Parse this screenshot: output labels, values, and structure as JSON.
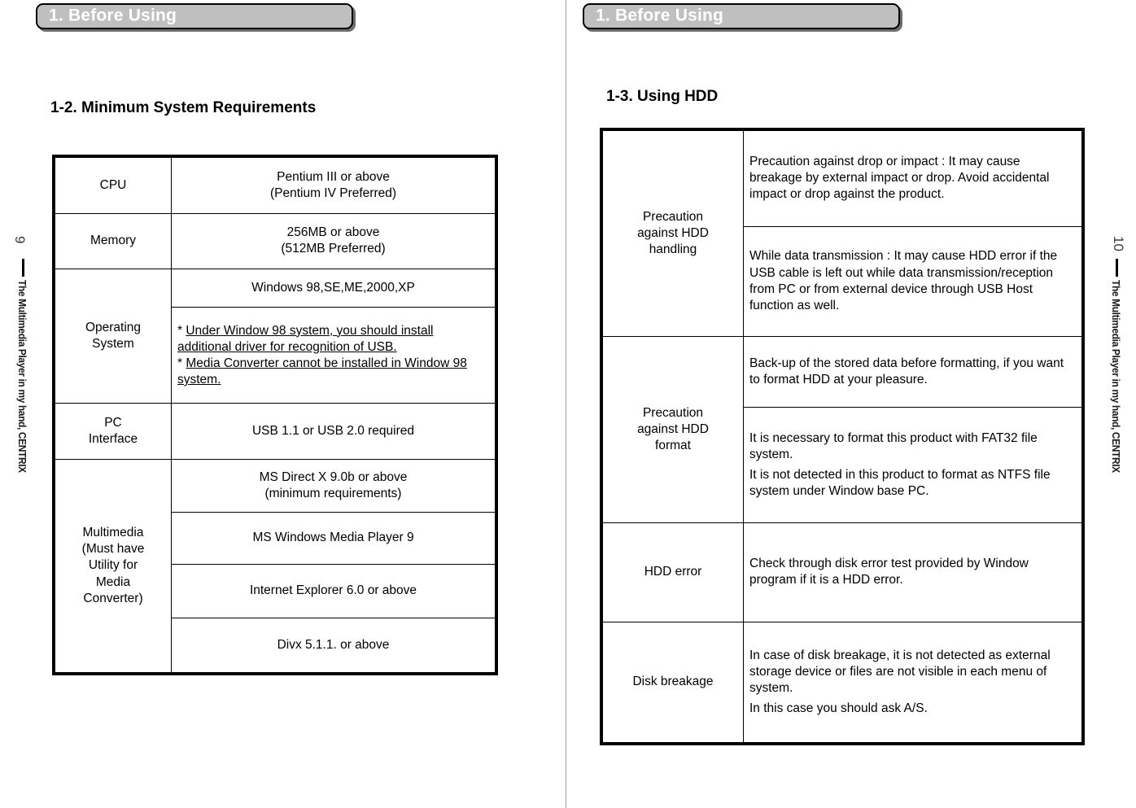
{
  "left_page": {
    "banner_label": "1. Before Using",
    "heading": "1-2. Minimum System Requirements",
    "page_number": "9",
    "brand_text": "The Multimedia Player in my hand, CENTRIX",
    "table": {
      "rows": [
        {
          "label": "CPU",
          "values": [
            {
              "line1": "Pentium III or above",
              "line2": "(Pentium IV Preferred)"
            }
          ]
        },
        {
          "label": "Memory",
          "values": [
            {
              "line1": "256MB or above",
              "line2": "(512MB Preferred)"
            }
          ]
        },
        {
          "label": "Operating System",
          "label_line1": "Operating",
          "label_line2": "System",
          "values": [
            {
              "line1": "Windows 98,SE,ME,2000,XP",
              "line2": ""
            }
          ],
          "notes": {
            "note1_prefix": "* ",
            "note1": "Under  Window 98 system, you should install additional driver for recognition of USB.",
            "note2_prefix": "* ",
            "note2": "Media Converter cannot be installed in Window 98 system."
          }
        },
        {
          "label": "PC Interface",
          "label_line1": "PC",
          "label_line2": "Interface",
          "values": [
            {
              "line1": "USB 1.1 or USB 2.0 required",
              "line2": ""
            }
          ]
        },
        {
          "label": "Multimedia (Must have Utility for Media Converter)",
          "label_line1": "Multimedia",
          "label_line2": "(Must have",
          "label_line3": "Utility for",
          "label_line4": "Media",
          "label_line5": "Converter)",
          "values": [
            {
              "line1": "MS Direct X 9.0b or above",
              "line2": "(minimum requirements)"
            },
            {
              "line1": "MS Windows Media Player 9",
              "line2": ""
            },
            {
              "line1": "Internet Explorer 6.0 or above",
              "line2": ""
            },
            {
              "line1": "Divx 5.1.1. or above",
              "line2": ""
            }
          ]
        }
      ]
    }
  },
  "right_page": {
    "banner_label": "1. Before Using",
    "heading": "1-3. Using HDD",
    "page_number": "10",
    "brand_text": "The Multimedia Player in my hand, CENTRIX",
    "table": {
      "rows": [
        {
          "label_line1": "Precaution",
          "label_line2": "against HDD",
          "label_line3": "handling",
          "cells": [
            "Precaution against drop or impact : It may cause breakage by external impact or drop. Avoid accidental impact or drop against the product.",
            "While data transmission : It may cause HDD error if the USB cable is left out while data transmission/reception from PC or from external device through USB Host function as well."
          ]
        },
        {
          "label_line1": "Precaution",
          "label_line2": "against HDD",
          "label_line3": "format",
          "cells": [
            "Back-up of the stored data before formatting, if you want to format HDD at your pleasure.",
            "It is necessary to format this product with FAT32 file system.|It is not detected in this product to format as NTFS file system under Window base PC."
          ]
        },
        {
          "label_line1": "HDD error",
          "label_line2": "",
          "label_line3": "",
          "cells": [
            "Check  through disk error test provided by Window program if it is a HDD error."
          ]
        },
        {
          "label_line1": "Disk breakage",
          "label_line2": "",
          "label_line3": "",
          "cells": [
            "In case of disk breakage, it is not detected as external storage device or files are not visible in each menu of system.|In this case you should ask A/S."
          ]
        }
      ]
    }
  },
  "colors": {
    "banner_fill": "#bfbfbf",
    "banner_text": "#ffffff",
    "banner_border": "#000000",
    "banner_shadow": "#6d6d6d",
    "spine": "#9a9a9a",
    "table_border": "#000000"
  }
}
